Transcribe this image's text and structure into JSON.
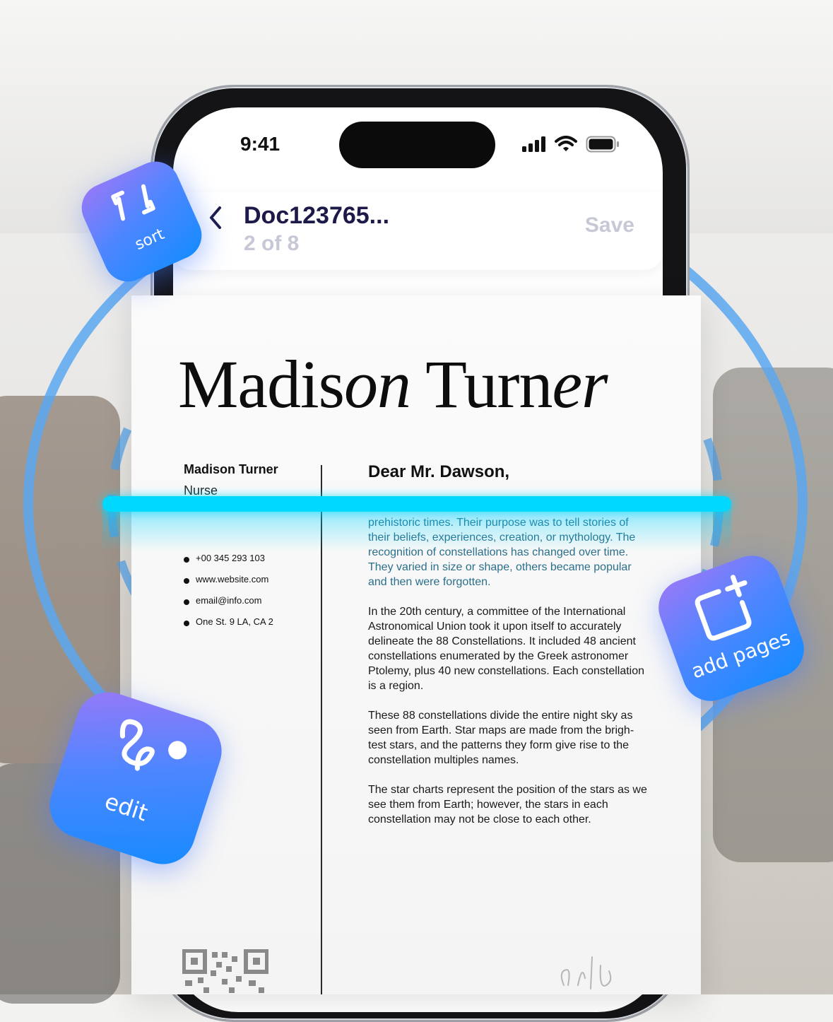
{
  "status_bar": {
    "time": "9:41"
  },
  "header": {
    "title": "Doc123765...",
    "page_count": "2 of 8",
    "save_label": "Save"
  },
  "document": {
    "name_parts": [
      "Madis",
      "on",
      " Turn",
      "er"
    ],
    "sidebar": {
      "name": "Madison Turner",
      "role": "Nurse",
      "contacts": [
        "+00 345 293 103",
        "www.website.com",
        "email@info.com",
        "One St. 9 LA, CA 2"
      ]
    },
    "greeting": "Dear Mr. Dawson,",
    "paragraphs": [
      "prehistoric times. Their purpose was to tell stories of their beliefs, experiences, creation, or mythology. The recognition of constellations has changed over time. They varied in size or shape, others became popular and then were forgotten.",
      "In the 20th century, a committee of the International Astronomical Union took it upon itself to accurately delineate the 88 Constellations. It included 48 ancient constellations enumerated by the Greek astronomer Ptolemy, plus 40 new constellations. Each constellation is a region.",
      "These 88 constellations divide the entire night sky as seen from Earth. Star maps are made from the brigh-test stars, and the patterns they form give rise to the constellation  multiples names.",
      "The star charts represent the position of the stars as we see them from Earth; however, the stars in each constellation may not be close to each other."
    ]
  },
  "badges": {
    "sort": "sort",
    "edit": "edit",
    "add_pages": "add pages"
  },
  "icons": [
    "back-chevron-icon",
    "signal-icon",
    "wifi-icon",
    "battery-icon",
    "sort-icon",
    "edit-signature-icon",
    "add-page-icon"
  ],
  "colors": {
    "accent_start": "#9a78f7",
    "accent_end": "#158bff",
    "scan_line": "#00d8ff",
    "title": "#1d1a4a",
    "muted": "#c6c8d6"
  }
}
